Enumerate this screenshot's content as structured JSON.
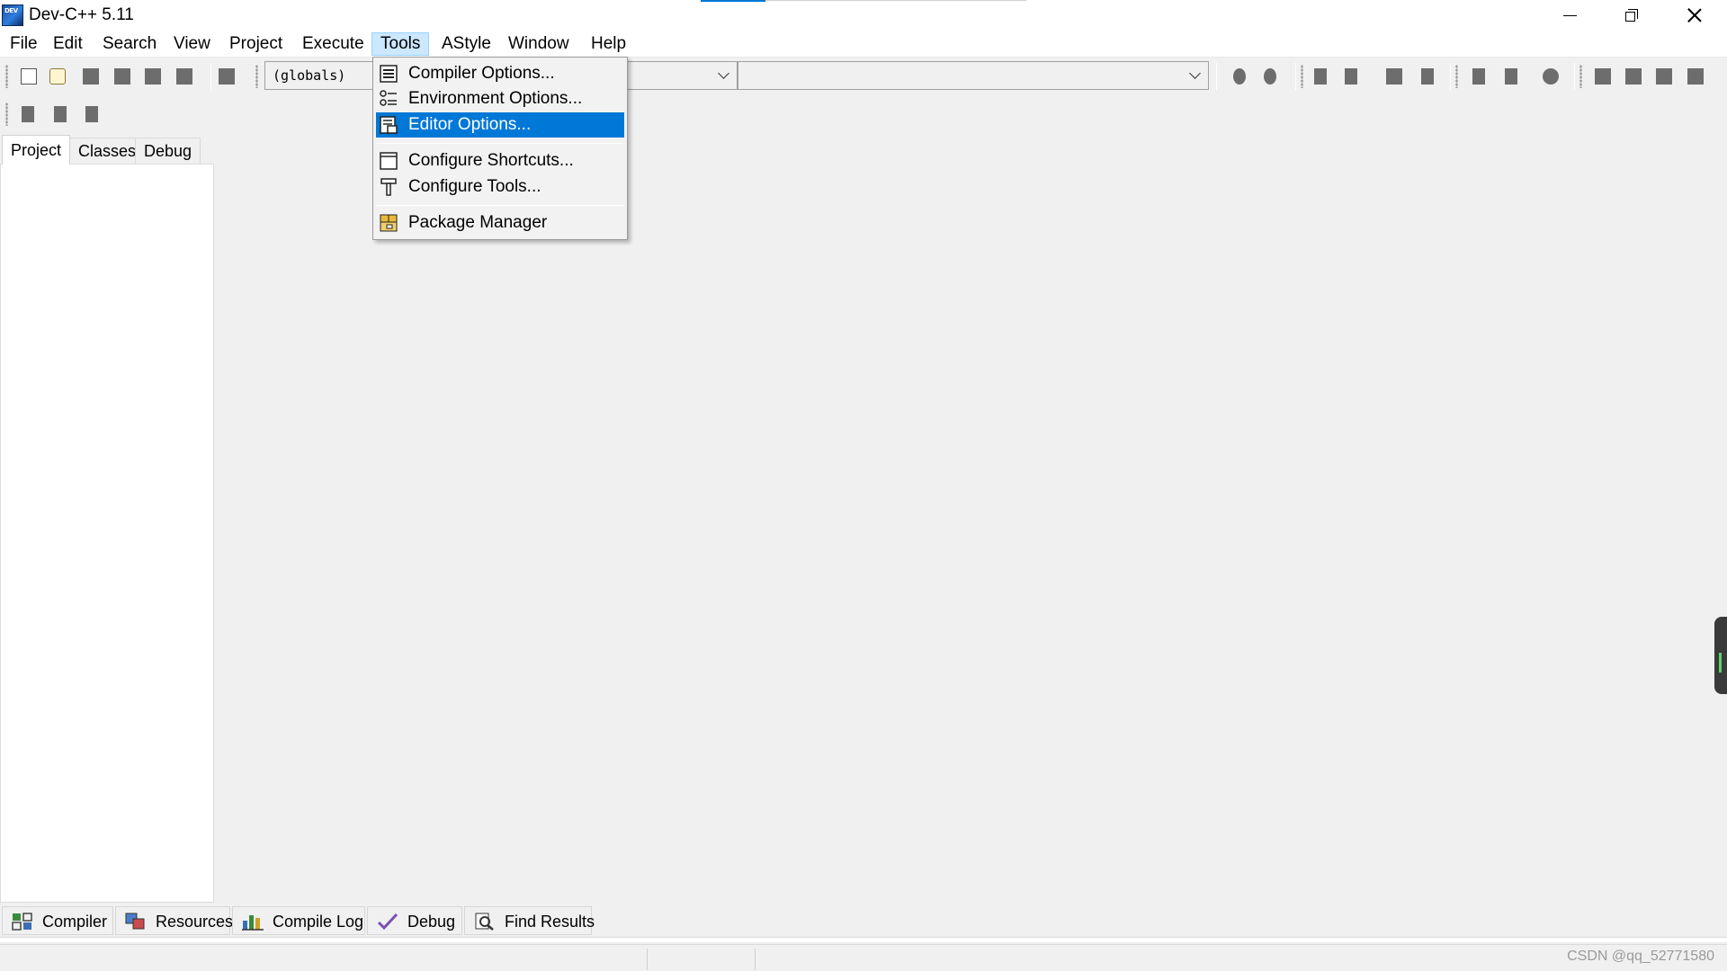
{
  "window": {
    "title": "Dev-C++ 5.11",
    "app_icon_text": "DEV"
  },
  "menubar": {
    "items": [
      "File",
      "Edit",
      "Search",
      "View",
      "Project",
      "Execute",
      "Tools",
      "AStyle",
      "Window",
      "Help"
    ],
    "active": "Tools"
  },
  "toolbar": {
    "scope_combo_value": "(globals)"
  },
  "tools_menu": {
    "items": [
      {
        "label": "Compiler Options...",
        "icon": "compiler-options-icon"
      },
      {
        "label": "Environment Options...",
        "icon": "environment-options-icon"
      },
      {
        "label": "Editor Options...",
        "icon": "editor-options-icon",
        "highlighted": true
      },
      {
        "label": "Configure Shortcuts...",
        "icon": "configure-shortcuts-icon"
      },
      {
        "label": "Configure Tools...",
        "icon": "configure-tools-icon"
      },
      {
        "label": "Package Manager",
        "icon": "package-manager-icon"
      }
    ],
    "highlight_color": "#0078d7"
  },
  "left_panel": {
    "tabs": [
      "Project",
      "Classes",
      "Debug"
    ],
    "active_tab": "Project"
  },
  "bottom_tabs": [
    {
      "label": "Compiler",
      "icon": "compiler-grid-icon"
    },
    {
      "label": "Resources",
      "icon": "resources-icon"
    },
    {
      "label": "Compile Log",
      "icon": "compile-log-chart-icon"
    },
    {
      "label": "Debug",
      "icon": "debug-check-icon"
    },
    {
      "label": "Find Results",
      "icon": "find-results-icon"
    }
  ],
  "statusbar": {
    "watermark": "CSDN @qq_52771580"
  }
}
